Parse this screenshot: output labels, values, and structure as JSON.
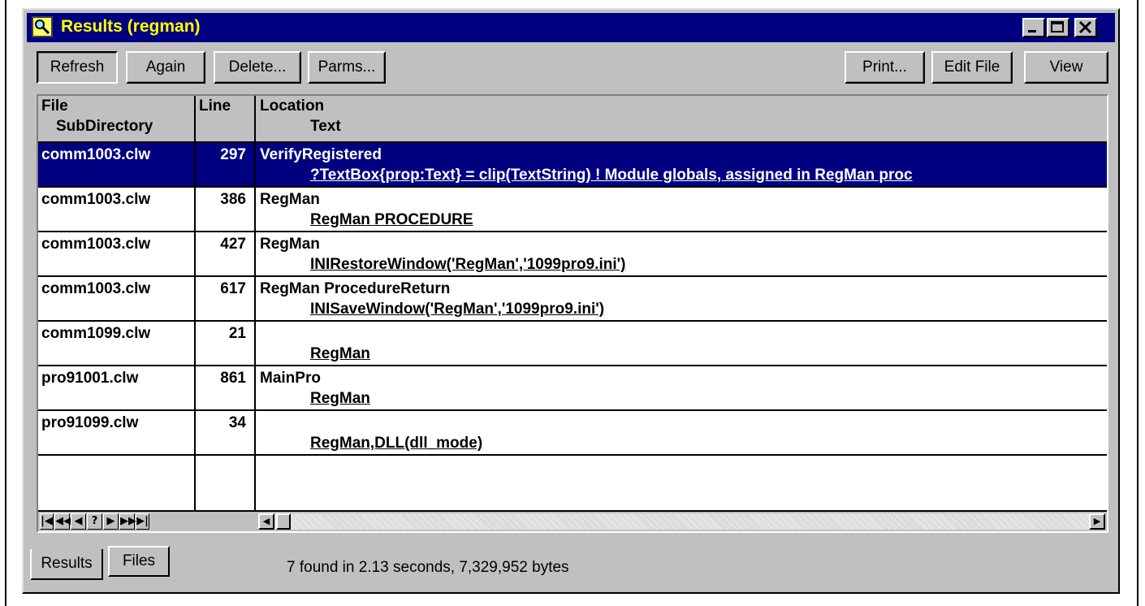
{
  "window": {
    "title": "Results (regman)"
  },
  "toolbar": {
    "refresh": "Refresh",
    "again": "Again",
    "delete": "Delete...",
    "parms": "Parms...",
    "print": "Print...",
    "edit_file": "Edit File",
    "view": "View"
  },
  "columns": {
    "file": "File",
    "subdirectory": "SubDirectory",
    "line": "Line",
    "location": "Location",
    "text": "Text"
  },
  "rows": [
    {
      "file": "comm1003.clw",
      "line": "297",
      "location": "VerifyRegistered",
      "text": "?TextBox{prop:Text} = clip(TextString) ! Module globals, assigned in RegMan proc",
      "selected": true
    },
    {
      "file": "comm1003.clw",
      "line": "386",
      "location": "RegMan",
      "text": "RegMan PROCEDURE",
      "selected": false
    },
    {
      "file": "comm1003.clw",
      "line": "427",
      "location": "RegMan",
      "text": "INIRestoreWindow('RegMan','1099pro9.ini')",
      "selected": false
    },
    {
      "file": "comm1003.clw",
      "line": "617",
      "location": "RegMan  ProcedureReturn",
      "text": "INISaveWindow('RegMan','1099pro9.ini')",
      "selected": false
    },
    {
      "file": "comm1099.clw",
      "line": "21",
      "location": "",
      "text": "RegMan",
      "selected": false
    },
    {
      "file": "pro91001.clw",
      "line": "861",
      "location": "MainPro",
      "text": "RegMan",
      "selected": false
    },
    {
      "file": "pro91099.clw",
      "line": "34",
      "location": "",
      "text": "RegMan,DLL(dll_mode)",
      "selected": false
    }
  ],
  "navigation": [
    "|◀",
    "◀◀",
    "◀",
    "?",
    "▶",
    "▶▶",
    "▶|"
  ],
  "tabs": {
    "results": "Results",
    "files": "Files"
  },
  "status": "7 found in 2.13 seconds,  7,329,952 bytes",
  "colors": {
    "title_bg": "#000080",
    "title_text": "#ffff00",
    "selection_bg": "#000080",
    "face": "#c0c0c0"
  }
}
